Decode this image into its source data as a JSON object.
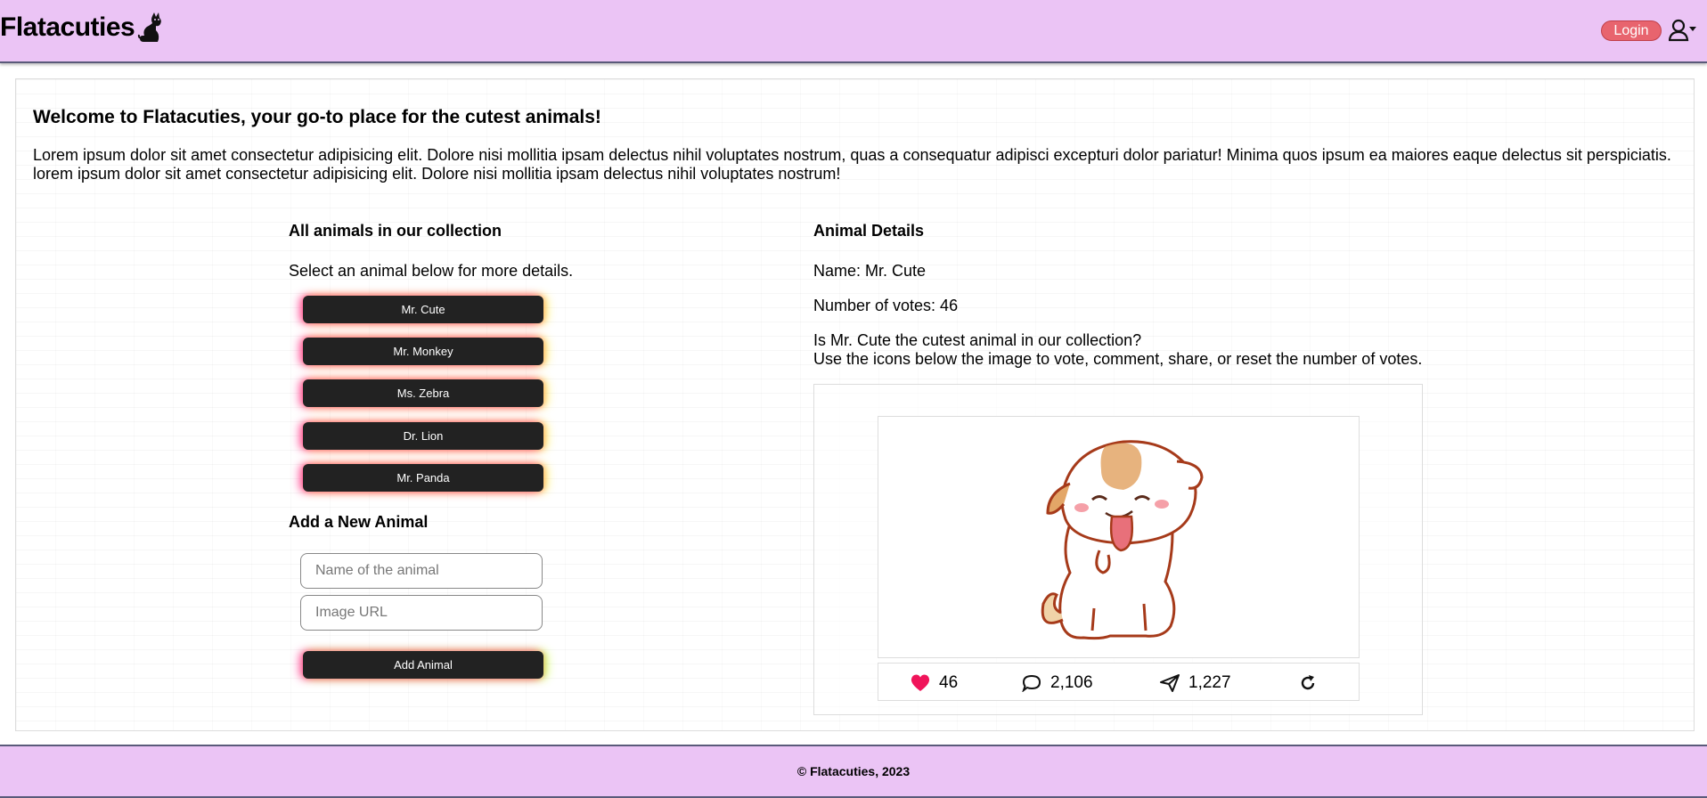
{
  "header": {
    "brand": "Flatacuties",
    "brand_icon": "cat-icon",
    "login_label": "Login",
    "user_icon": "user-dropdown-icon",
    "background": "#ebc4f5",
    "login_color": "#e8646e"
  },
  "welcome": {
    "title": "Welcome to Flatacuties, your go-to place for the cutest animals!",
    "intro": "Lorem ipsum dolor sit amet consectetur adipisicing elit. Dolore nisi mollitia ipsam delectus nihil voluptates nostrum, quas a consequatur adipisci excepturi dolor pariatur! Minima quos ipsum ea maiores eaque delectus sit perspiciatis. lorem ipsum dolor sit amet consectetur adipisicing elit. Dolore nisi mollitia ipsam delectus nihil voluptates nostrum!"
  },
  "collection": {
    "title": "All animals in our collection",
    "subtitle": "Select an animal below for more details.",
    "animals": [
      "Mr. Cute",
      "Mr. Monkey",
      "Ms. Zebra",
      "Dr. Lion",
      "Mr. Panda"
    ]
  },
  "add_form": {
    "title": "Add a New Animal",
    "name_placeholder": "Name of the animal",
    "image_placeholder": "Image URL",
    "submit_label": "Add Animal"
  },
  "details": {
    "title": "Animal Details",
    "name_line": "Name: Mr. Cute",
    "votes_line": "Number of votes: 46",
    "question": "Is Mr. Cute the cutest animal in our collection?",
    "instructions": "Use the icons below the image to vote, comment, share, or reset the number of votes.",
    "image_icon": "puppy-illustration",
    "actions": {
      "likes": "46",
      "comments": "2,106",
      "shares": "1,227",
      "heart_color": "#f0145a"
    }
  },
  "footer": {
    "text": "© Flatacuties, 2023"
  }
}
